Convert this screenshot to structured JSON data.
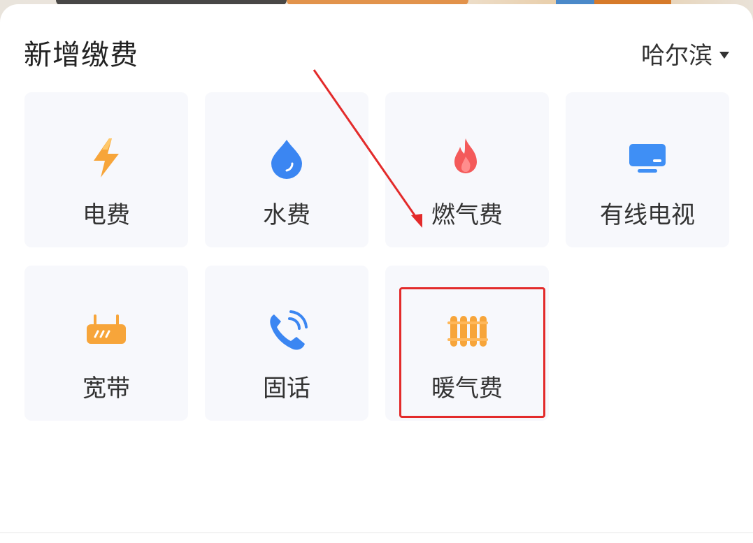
{
  "header": {
    "title": "新增缴费",
    "city": "哈尔滨"
  },
  "items": [
    {
      "label": "电费",
      "icon": "lightning-icon",
      "color": "#f7a53a"
    },
    {
      "label": "水费",
      "icon": "water-drop-icon",
      "color": "#3b86f2"
    },
    {
      "label": "燃气费",
      "icon": "flame-icon",
      "color": "#f45a5a"
    },
    {
      "label": "有线电视",
      "icon": "tv-icon",
      "color": "#3f8ff5"
    },
    {
      "label": "宽带",
      "icon": "router-icon",
      "color": "#f7a53a"
    },
    {
      "label": "固话",
      "icon": "phone-icon",
      "color": "#3b86f2"
    },
    {
      "label": "暖气费",
      "icon": "radiator-icon",
      "color": "#f7a53a"
    }
  ],
  "colors": {
    "annotation": "#e32b2b",
    "tile_bg": "#f7f8fc"
  }
}
